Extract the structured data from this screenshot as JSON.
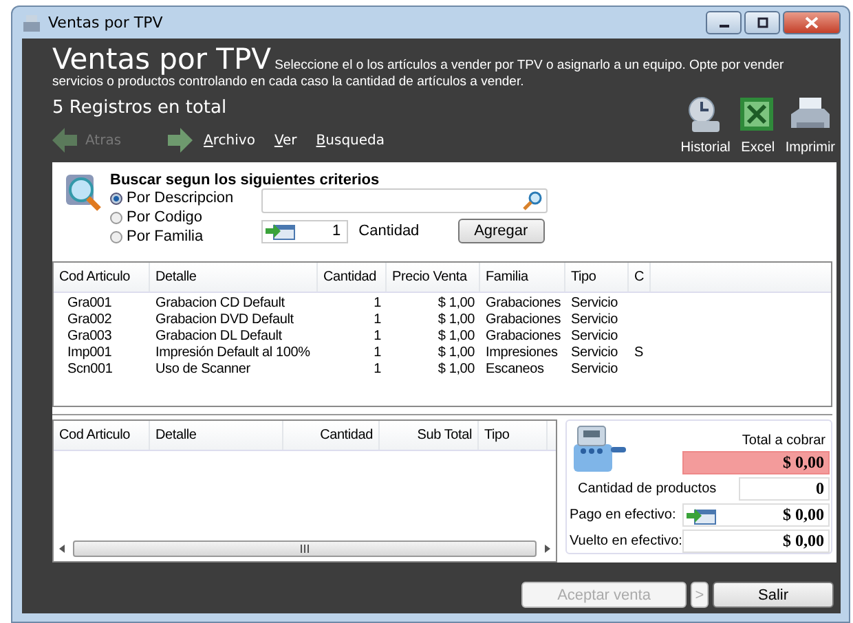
{
  "window": {
    "title": "Ventas por TPV"
  },
  "header": {
    "title": "Ventas por TPV",
    "description": "Seleccione el o los artículos a vender por TPV o asignarlo a un equipo. Opte por vender servicios o productos controlando en cada caso la cantidad de artículos a vender.",
    "record_count": "5 Registros en total"
  },
  "navigation": [
    {
      "kind": "back",
      "label": "Atras",
      "disabled": true
    },
    {
      "kind": "forward",
      "disabled": false
    }
  ],
  "menu": [
    "Archivo",
    "Ver",
    "Busqueda"
  ],
  "tools": [
    {
      "kind": "history",
      "label": "Historial"
    },
    {
      "kind": "excel",
      "label": "Excel"
    },
    {
      "kind": "print",
      "label": "Imprimir"
    }
  ],
  "search": {
    "title": "Buscar segun los siguientes criterios",
    "options": [
      {
        "label": "Por Descripcion",
        "selected": true
      },
      {
        "label": "Por Codigo",
        "selected": false
      },
      {
        "label": "Por Familia",
        "selected": false
      }
    ],
    "quantity": "1",
    "quantity_label": "Cantidad",
    "add_button": "Agregar"
  },
  "articles": {
    "columns": [
      "Cod Articulo",
      "Detalle",
      "Cantidad",
      "Precio Venta",
      "Familia",
      "Tipo",
      "C"
    ],
    "rows": [
      [
        "Gra001",
        "Grabacion CD Default",
        "1",
        "$ 1,00",
        "Grabaciones",
        "Servicio"
      ],
      [
        "Gra002",
        "Grabacion DVD Default",
        "1",
        "$ 1,00",
        "Grabaciones",
        "Servicio"
      ],
      [
        "Gra003",
        "Grabacion DL Default",
        "1",
        "$ 1,00",
        "Grabaciones",
        "Servicio"
      ],
      [
        "Imp001",
        "Impresión Default al 100%",
        "1",
        "$ 1,00",
        "Impresiones",
        "Servicio",
        "S"
      ],
      [
        "Scn001",
        "Uso de Scanner",
        "1",
        "$ 1,00",
        "Escaneos",
        "Servicio"
      ]
    ]
  },
  "cart": {
    "columns": [
      "Cod Articulo",
      "Detalle",
      "Cantidad",
      "Sub Total",
      "Tipo"
    ]
  },
  "summary": {
    "total_label": "Total a cobrar",
    "total": "$ 0,00",
    "quantity_label": "Cantidad de productos",
    "quantity": "0",
    "payment_label": "Pago en efectivo:",
    "payment": "$ 0,00",
    "change_label": "Vuelto en efectivo:",
    "change": "$ 0,00"
  },
  "footer": [
    {
      "kind": "accept",
      "label": "Aceptar venta",
      "disabled": true
    },
    {
      "kind": "more",
      "label": ">",
      "disabled": true
    },
    {
      "kind": "exit",
      "label": "Salir",
      "disabled": false
    }
  ]
}
